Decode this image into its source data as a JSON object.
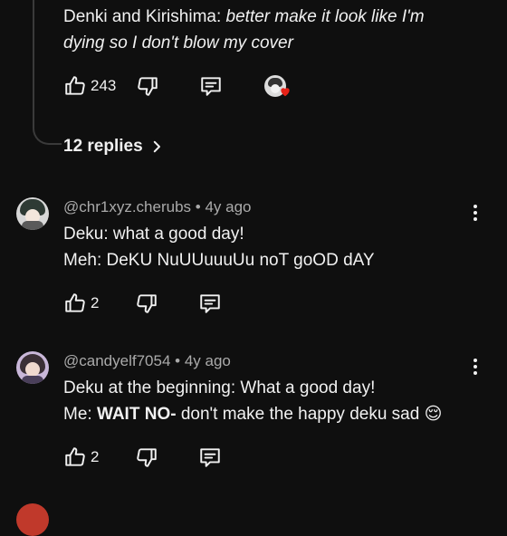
{
  "top_comment": {
    "line1_prefix": "Denki and Kirishima: ",
    "line1_italic": "better make it look like I'm",
    "line2_italic": "dying so I don't blow my cover",
    "like_count": "243",
    "heart_icon": "creator-heart-icon"
  },
  "replies_toggle": {
    "label": "12 replies"
  },
  "comments": [
    {
      "author": "@chr1xyz.cherubs",
      "separator": " • ",
      "age": "4y ago",
      "line1": "Deku: what a good day!",
      "line2": "Meh: DeKU NuUUuuuUu noT goOD dAY",
      "like_count": "2"
    },
    {
      "author": "@candyelf7054",
      "separator": " • ",
      "age": "4y ago",
      "line1": "Deku at the beginning: What a good day!",
      "line2_prefix": "Me: ",
      "line2_bold": "WAIT NO-",
      "line2_suffix": " don't make the happy deku sad ",
      "line2_emoji": "😌",
      "like_count": "2"
    }
  ],
  "colors": {
    "background": "#0f0f0f",
    "text": "#f1f1f1",
    "meta": "#aaaaaa",
    "heart": "#e62117"
  }
}
